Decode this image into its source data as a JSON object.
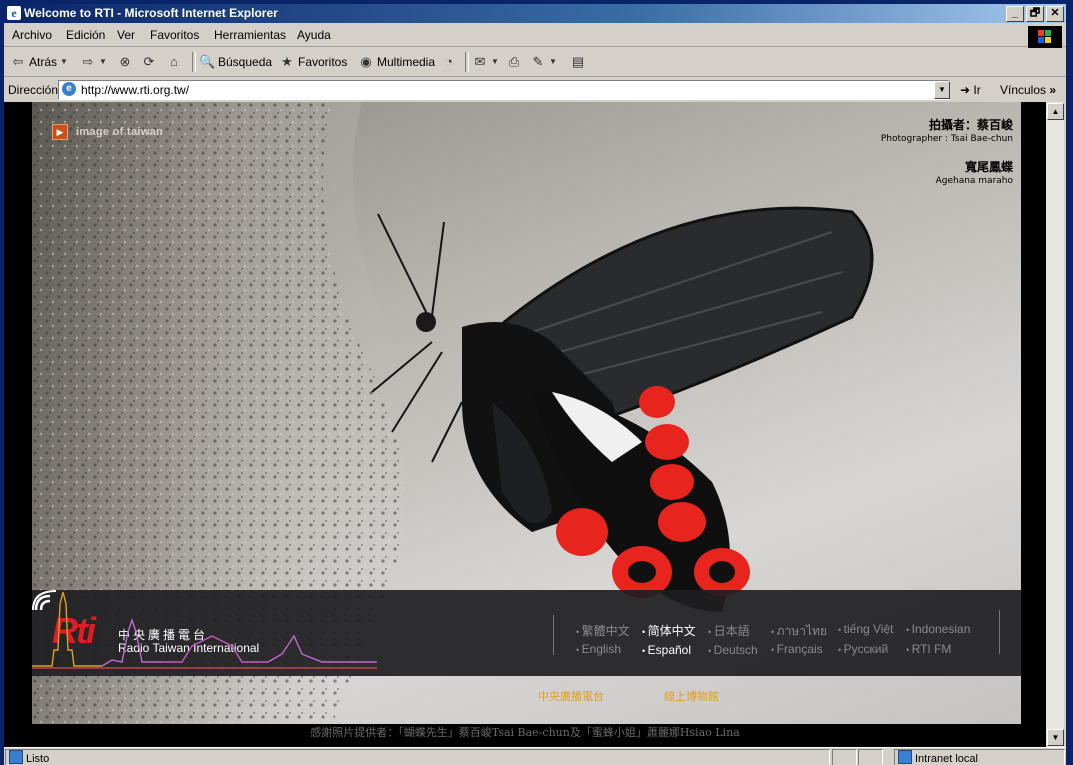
{
  "window": {
    "title": "Welcome to RTI - Microsoft Internet Explorer",
    "buttons": [
      "_",
      "🗗",
      "✕"
    ]
  },
  "menu": [
    "Archivo",
    "Edición",
    "Ver",
    "Favoritos",
    "Herramientas",
    "Ayuda"
  ],
  "toolbar": {
    "back_label": "Atrás",
    "search_label": "Búsqueda",
    "favorites_label": "Favoritos",
    "multimedia_label": "Multimedia"
  },
  "address": {
    "label": "Dirección",
    "url": "http://www.rti.org.tw/",
    "go_label": "Ir",
    "links_label": "Vínculos"
  },
  "page": {
    "brand_text": "image of taiwan",
    "photographer_zh": "拍攝者：蔡百峻",
    "photographer_en": "Photographer : Tsai Bae-chun",
    "species_zh": "寬尾鳳蝶",
    "species_en": "Agehana maraho",
    "logo_text": "Rti",
    "station_zh": "中央廣播電台",
    "station_en": "Radio Taiwan International",
    "languages": [
      {
        "label": "繁體中文",
        "active": false
      },
      {
        "label": "简体中文",
        "active": true
      },
      {
        "label": "日本語",
        "active": false
      },
      {
        "label": "ภาษาไทย",
        "active": false
      },
      {
        "label": "tiếng Việt",
        "active": false
      },
      {
        "label": "Indonesian",
        "active": false
      },
      {
        "label": "English",
        "active": false
      },
      {
        "label": "Español",
        "active": true
      },
      {
        "label": "Deutsch",
        "active": false
      },
      {
        "label": "Français",
        "active": false
      },
      {
        "label": "Русский",
        "active": false
      },
      {
        "label": "RTI FM",
        "active": false
      }
    ],
    "sub_links": [
      "中央廣播電台",
      "線上博物館"
    ],
    "thanks": "感謝照片提供者：「蝴蝶先生」蔡百峻Tsai Bae-chun及「蜜蜂小姐」蕭麗娜Hsiao Lina"
  },
  "status": {
    "text": "Listo",
    "zone": "Intranet local"
  },
  "colors": {
    "title_blue": "#0a246a",
    "rti_red": "#e31b23",
    "link_gold": "#e0a020"
  }
}
